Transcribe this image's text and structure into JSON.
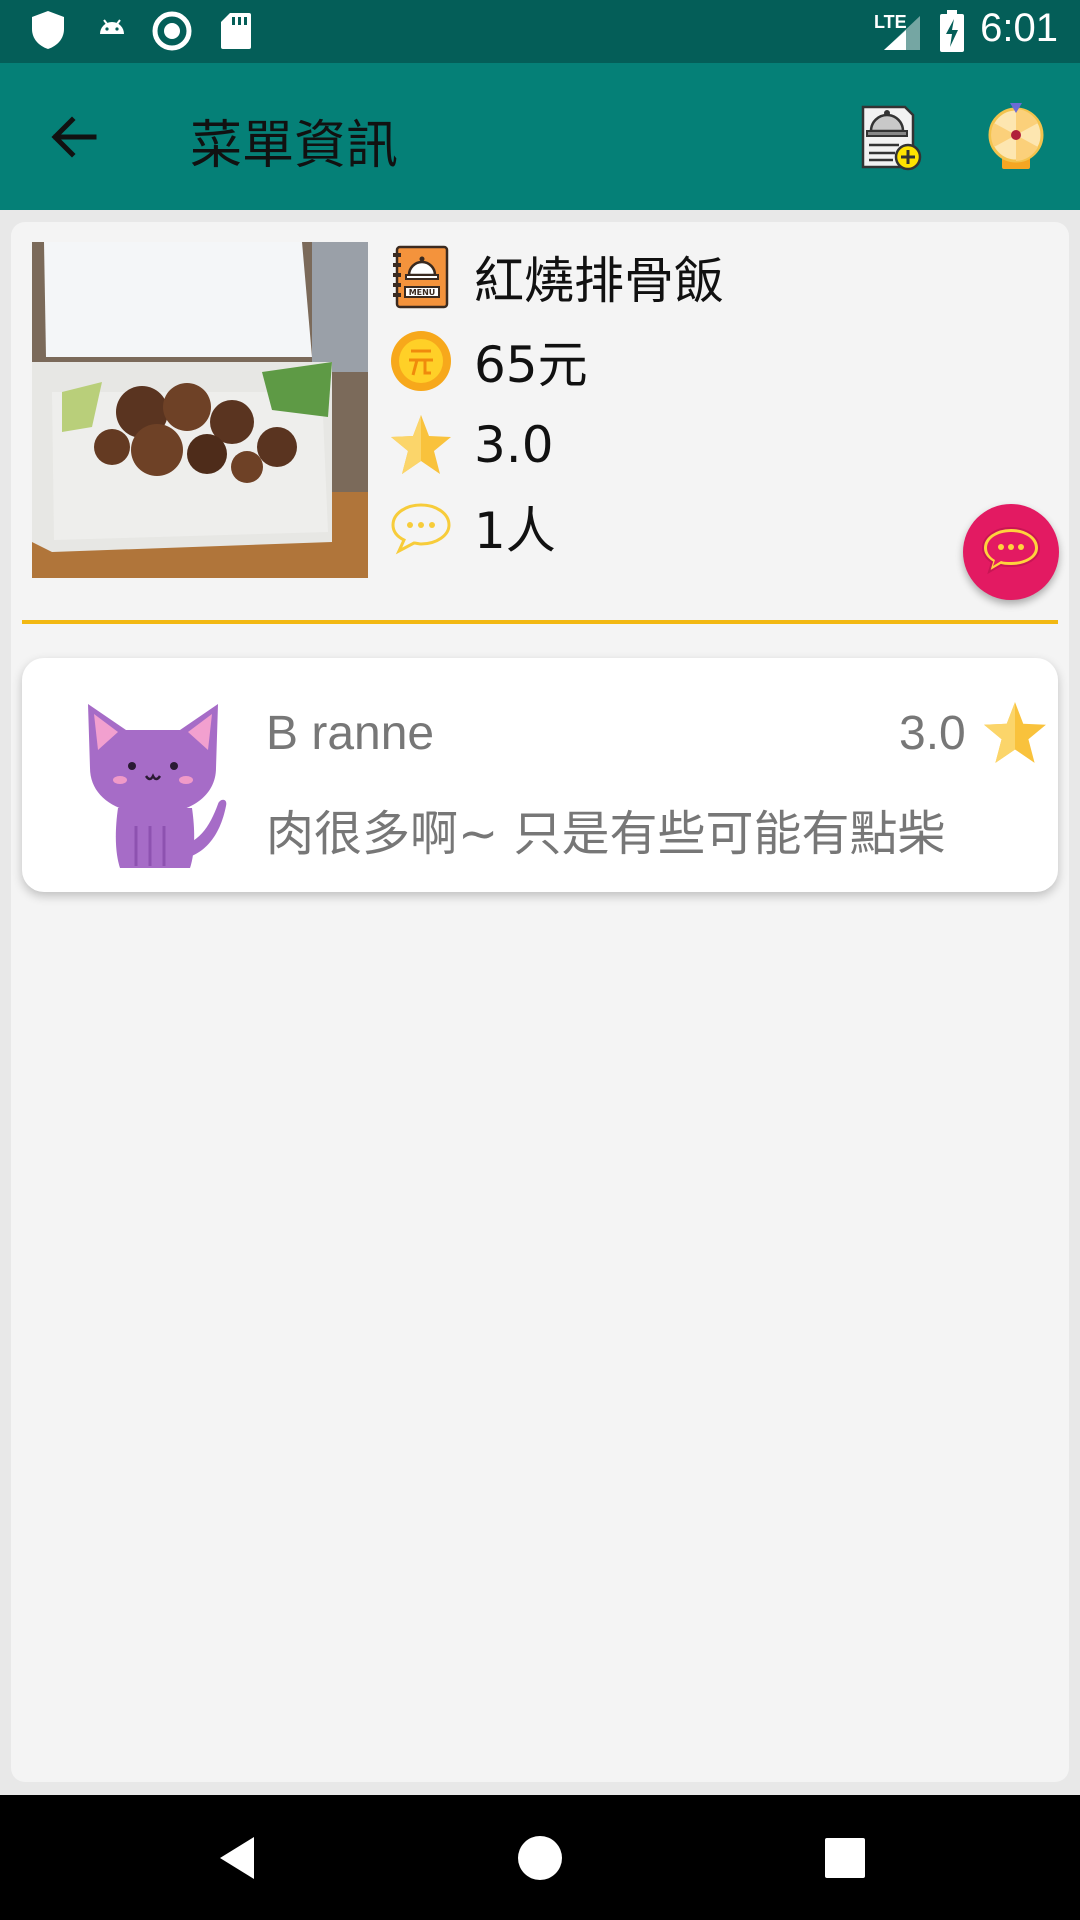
{
  "status_bar": {
    "time": "6:01",
    "network_label": "LTE",
    "icons": [
      "shield-icon",
      "android-icon",
      "sync-icon",
      "sd-card-icon",
      "signal-icon",
      "battery-charging-icon"
    ]
  },
  "app_bar": {
    "title": "菜單資訊",
    "back_icon": "arrow-left-icon",
    "actions": [
      "add-order-icon",
      "lucky-wheel-icon"
    ]
  },
  "dish": {
    "name": "紅燒排骨飯",
    "price": "65元",
    "rating": "3.0",
    "review_count": "1人",
    "icons": [
      "menu-book-icon",
      "yuan-coin-icon",
      "star-icon",
      "comment-icon"
    ]
  },
  "reviews": [
    {
      "user": "B ranne",
      "rating": "3.0",
      "comment": "肉很多啊~ 只是有些可能有點柴",
      "avatar": "cat-avatar"
    }
  ],
  "colors": {
    "status_bar": "#045e58",
    "app_bar": "#058077",
    "fab": "#e31a62",
    "divider": "#f2b812",
    "background": "#f4f4f4"
  }
}
